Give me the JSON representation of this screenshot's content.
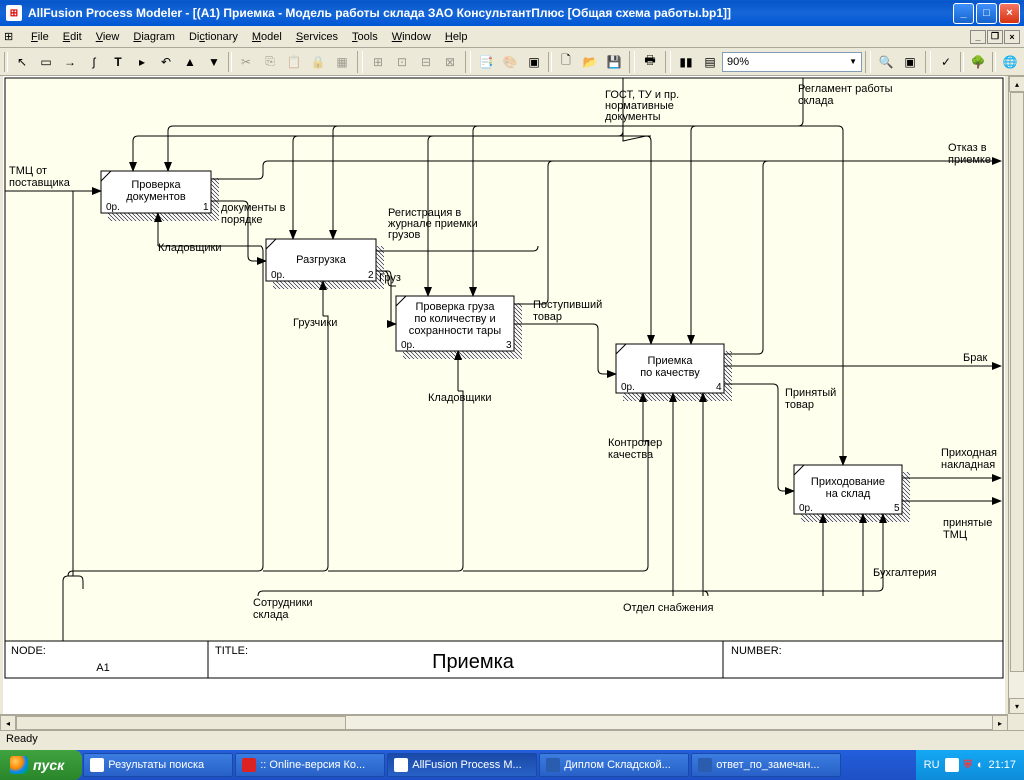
{
  "window": {
    "title": "AllFusion Process Modeler  - [(A1) Приемка - Модель работы склада ЗАО КонсультантПлюс  [Общая схема работы.bp1]]"
  },
  "menu": {
    "file": "File",
    "edit": "Edit",
    "view": "View",
    "diagram": "Diagram",
    "dictionary": "Dictionary",
    "model": "Model",
    "services": "Services",
    "tools": "Tools",
    "window": "Window",
    "help": "Help"
  },
  "zoom": {
    "value": "90%"
  },
  "status": {
    "text": "Ready"
  },
  "diagram": {
    "node_label": "NODE:",
    "node_value": "A1",
    "title_label": "TITLE:",
    "title_value": "Приемка",
    "number_label": "NUMBER:",
    "boxes": {
      "b1": {
        "t1": "Проверка",
        "t2": "документов",
        "l": "0р.",
        "r": "1"
      },
      "b2": {
        "t1": "Разгрузка",
        "l": "0р.",
        "r": "2"
      },
      "b3": {
        "t1": "Проверка груза",
        "t2": "по количеству и",
        "t3": "сохранности тары",
        "l": "0р.",
        "r": "3"
      },
      "b4": {
        "t1": "Приемка",
        "t2": "по качеству",
        "l": "0р.",
        "r": "4"
      },
      "b5": {
        "t1": "Приходование",
        "t2": "на склад",
        "l": "0р.",
        "r": "5"
      }
    },
    "labels": {
      "in1": "ТМЦ от",
      "in1b": "поставщика",
      "top1": "ГОСТ, ТУ и пр.",
      "top1b": "нормативные",
      "top1c": "документы",
      "top2": "Регламент работы",
      "top2b": "склада",
      "out1": "Отказ в",
      "out1b": "приемке",
      "out2": "Брак",
      "out3": "Приходная",
      "out3b": "накладная",
      "out4": "принятые",
      "out4b": "ТМЦ",
      "a12": "документы в",
      "a12b": "порядке",
      "a23": "Груз",
      "reg": "Регистрация в",
      "regb": "журнале приемки",
      "regc": "грузов",
      "a34": "Поступивший",
      "a34b": "товар",
      "a45": "Принятый",
      "a45b": "товар",
      "m1": "Кладовщики",
      "m2": "Грузчики",
      "m3": "Кладовщики",
      "m4": "Контролер",
      "m4b": "качества",
      "m5": "Отдел снабжения",
      "m6": "Бухгалтерия",
      "m7": "Сотрудники",
      "m7b": "склада"
    }
  },
  "taskbar": {
    "start": "пуск",
    "lang": "RU",
    "time": "21:17",
    "tasks": [
      {
        "label": "Результаты поиска"
      },
      {
        "label": ":: Online-версия Ко..."
      },
      {
        "label": "AllFusion Process M..."
      },
      {
        "label": "Диплом Складской..."
      },
      {
        "label": "ответ_по_замечан..."
      }
    ]
  }
}
